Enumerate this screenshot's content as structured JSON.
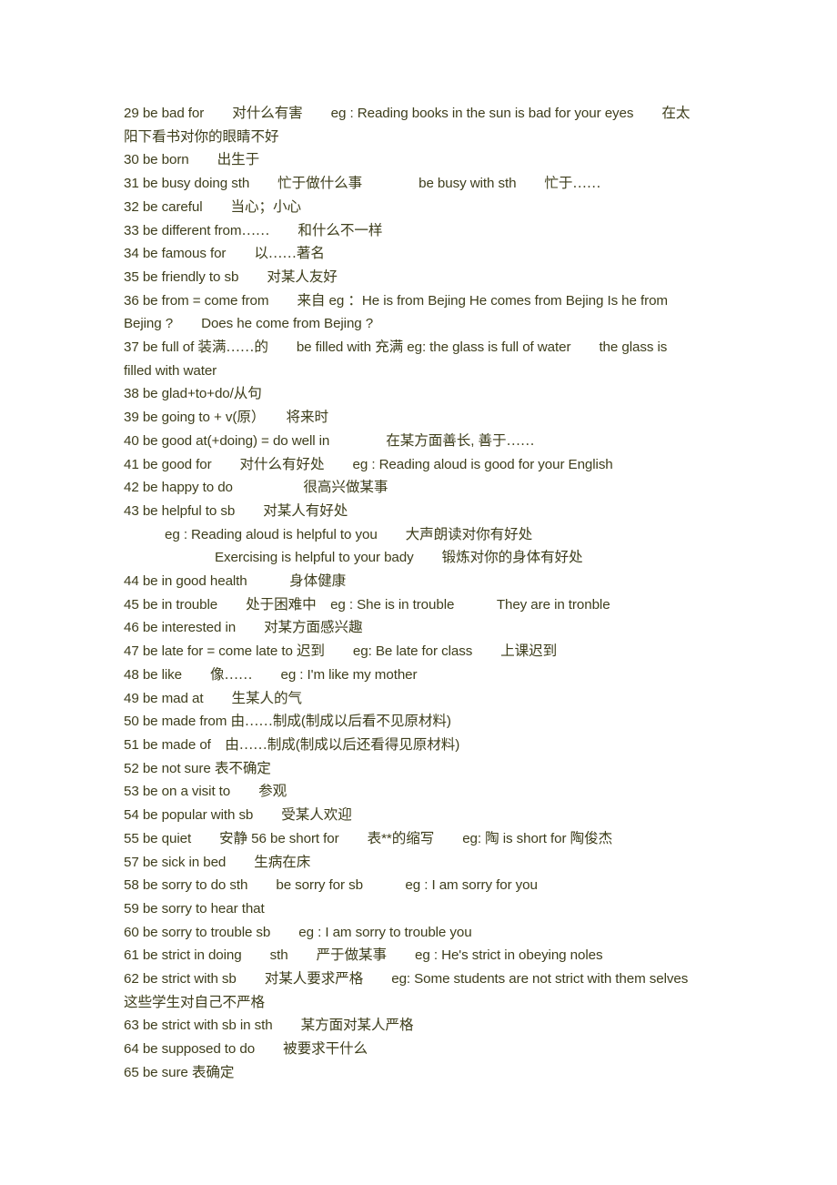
{
  "document": {
    "title": "English Phrases Study Notes",
    "text_color": "#3e3e1c",
    "background_color": "#ffffff",
    "entries": [
      {
        "num": "29",
        "lines": [
          "29 be bad for　　对什么有害　　eg : Reading books in the sun is bad for your eyes　　在太",
          "阳下看书对你的眼睛不好"
        ]
      },
      {
        "num": "30",
        "lines": [
          "30 be born　　出生于"
        ]
      },
      {
        "num": "31",
        "lines": [
          "31 be busy doing sth　　忙于做什么事　　　　be busy with sth　　忙于……"
        ]
      },
      {
        "num": "32",
        "lines": [
          "32 be careful　　当心；小心"
        ]
      },
      {
        "num": "33",
        "lines": [
          "33 be different from……　　和什么不一样"
        ]
      },
      {
        "num": "34",
        "lines": [
          "34 be famous for　　以……著名"
        ]
      },
      {
        "num": "35",
        "lines": [
          "35 be friendly to sb　　对某人友好"
        ]
      },
      {
        "num": "36",
        "lines": [
          "36 be from = come from　　来自 eg ：He is from Bejing He comes from Bejing Is he from",
          "Bejing ?　　Does he come from Bejing ?"
        ]
      },
      {
        "num": "37",
        "lines": [
          "37 be full of 装满……的　　be filled with 充满 eg: the glass is full of water　　the glass is",
          "filled with water"
        ]
      },
      {
        "num": "38",
        "lines": [
          "38 be glad+to+do/从句"
        ]
      },
      {
        "num": "39",
        "lines": [
          "39 be going to + v(原）　　将来时"
        ]
      },
      {
        "num": "40",
        "lines": [
          "40 be good at(+doing) = do well in　　　　在某方面善长, 善于……"
        ]
      },
      {
        "num": "41",
        "lines": [
          "41 be good for　　对什么有好处　　eg : Reading aloud is good for your English"
        ]
      },
      {
        "num": "42",
        "lines": [
          "42 be happy to do　　　　　很高兴做某事"
        ]
      },
      {
        "num": "43",
        "lines": [
          "43 be helpful to sb　　对某人有好处"
        ],
        "sub": [
          {
            "indent": 1,
            "text": "eg : Reading aloud is helpful to you　　大声朗读对你有好处"
          },
          {
            "indent": 2,
            "text": "Exercising is helpful to your bady　　锻炼对你的身体有好处"
          }
        ]
      },
      {
        "num": "44",
        "lines": [
          "44 be in good health　　　身体健康"
        ]
      },
      {
        "num": "45",
        "lines": [
          "45 be in trouble　　处于困难中　eg : She is in trouble　　　They are in tronble"
        ]
      },
      {
        "num": "46",
        "lines": [
          "46 be interested in　　对某方面感兴趣"
        ]
      },
      {
        "num": "47",
        "lines": [
          "47 be late for = come late to 迟到　　eg: Be late for class　　上课迟到"
        ]
      },
      {
        "num": "48",
        "lines": [
          "48 be like　　像……　　eg : I'm like my mother"
        ]
      },
      {
        "num": "49",
        "lines": [
          "49 be mad at　　生某人的气"
        ]
      },
      {
        "num": "50",
        "lines": [
          "50 be made from 由……制成(制成以后看不见原材料)"
        ]
      },
      {
        "num": "51",
        "lines": [
          "51 be made of　由……制成(制成以后还看得见原材料)"
        ]
      },
      {
        "num": "52",
        "lines": [
          "52 be not sure 表不确定"
        ]
      },
      {
        "num": "53",
        "lines": [
          "53 be on a visit to　　参观"
        ]
      },
      {
        "num": "54",
        "lines": [
          "54 be popular with sb　　受某人欢迎"
        ]
      },
      {
        "num": "55",
        "lines": [
          "55 be quiet　　安静 56 be short for　　表**的缩写　　eg: 陶 is short for 陶俊杰"
        ]
      },
      {
        "num": "57",
        "lines": [
          "57 be sick in bed　　生病在床"
        ]
      },
      {
        "num": "58",
        "lines": [
          "58 be sorry to do sth　　be sorry for sb　　　eg : I am sorry for you"
        ]
      },
      {
        "num": "59",
        "lines": [
          "59 be sorry to hear that"
        ]
      },
      {
        "num": "60",
        "lines": [
          "60 be sorry to trouble sb　　eg : I am sorry to trouble you"
        ]
      },
      {
        "num": "61",
        "lines": [
          "61 be strict in doing　　sth　　严于做某事　　eg : He's strict in obeying noles"
        ]
      },
      {
        "num": "62",
        "lines": [
          "62 be strict with sb　　对某人要求严格　　eg: Some students are not strict with them selves",
          "这些学生对自己不严格"
        ]
      },
      {
        "num": "63",
        "lines": [
          "63 be strict with sb in sth　　某方面对某人严格"
        ]
      },
      {
        "num": "64",
        "lines": [
          "64 be supposed to do　　被要求干什么"
        ]
      },
      {
        "num": "65",
        "lines": [
          "65 be sure 表确定"
        ]
      }
    ]
  }
}
